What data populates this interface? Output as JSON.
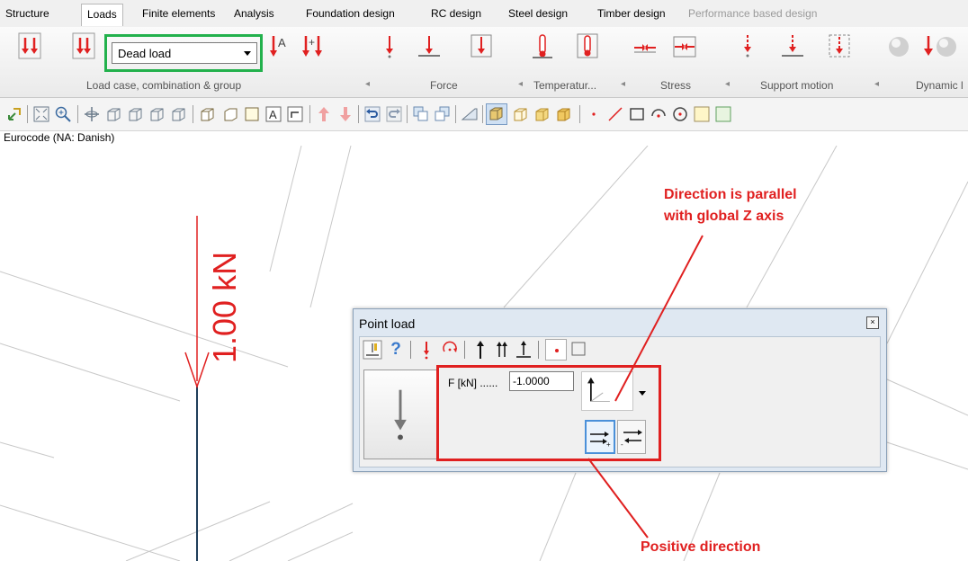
{
  "menu_tabs": [
    "Structure",
    "Loads",
    "Finite elements",
    "Analysis",
    "Foundation design",
    "RC design",
    "Steel design",
    "Timber design",
    "Performance based design"
  ],
  "active_tab": "Loads",
  "load_case": {
    "value": "Dead load"
  },
  "ribbon_groups": [
    "Load case, combination & group",
    "Force",
    "Temperatur...",
    "Stress",
    "Support motion",
    "Dynamic l"
  ],
  "standard_text": "Eurocode (NA: Danish)",
  "viewport": {
    "load_label": "1.00 kN"
  },
  "dialog": {
    "title": "Point load",
    "close_glyph": "×",
    "help_glyph": "?",
    "force_label": "F [kN] ......",
    "force_value": "-1.0000"
  },
  "annotations": {
    "direction_line1": "Direction is parallel",
    "direction_line2": "with global Z axis",
    "positive": "Positive direction"
  },
  "colors": {
    "load_red": "#e02020",
    "highlight_green": "#22b14c",
    "annotation_red": "#e02020",
    "selected_blue": "#4a90d9"
  }
}
